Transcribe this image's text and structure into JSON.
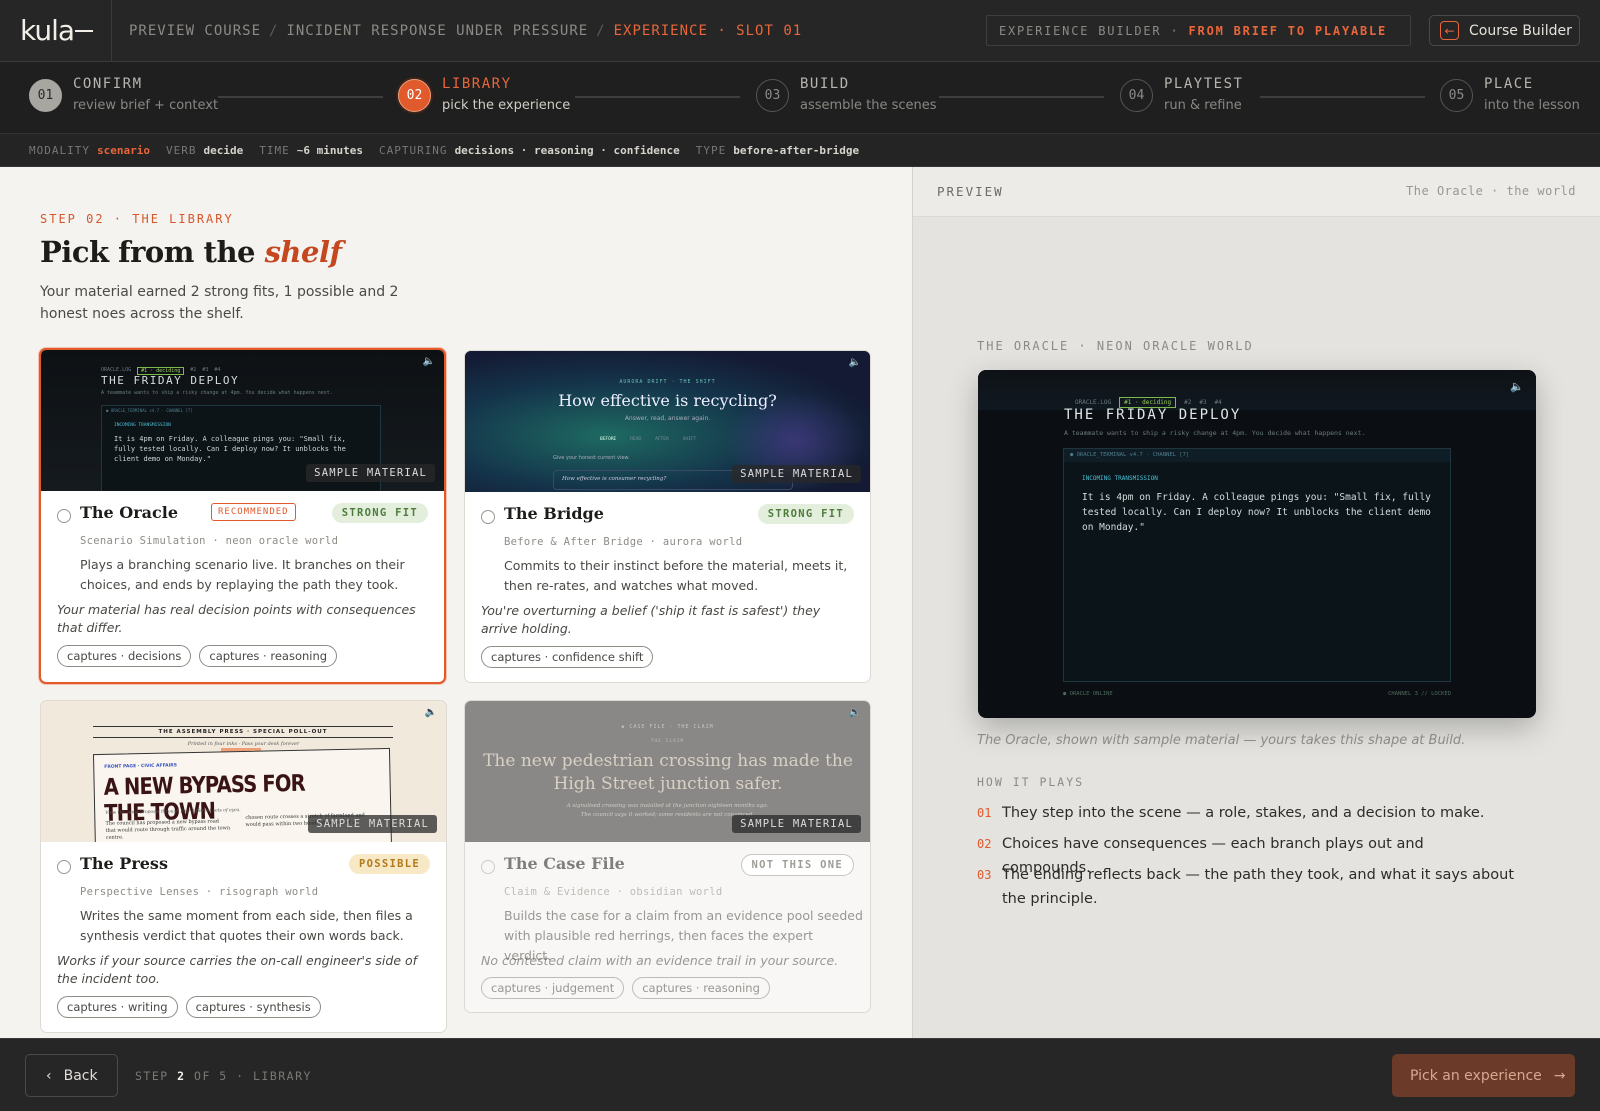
{
  "app": {
    "logo": "kula"
  },
  "breadcrumb": {
    "items": [
      "PREVIEW COURSE",
      "INCIDENT RESPONSE UNDER PRESSURE"
    ],
    "active": "EXPERIENCE · SLOT 01"
  },
  "builder_pill": {
    "label": "EXPERIENCE BUILDER ·",
    "highlight": "FROM BRIEF TO PLAYABLE"
  },
  "course_builder_button": {
    "label": "Course Builder"
  },
  "stepper": [
    {
      "num": "01",
      "title": "CONFIRM",
      "sub": "review brief + context",
      "state": "done"
    },
    {
      "num": "02",
      "title": "LIBRARY",
      "sub": "pick the experience",
      "state": "current"
    },
    {
      "num": "03",
      "title": "BUILD",
      "sub": "assemble the scenes",
      "state": "todo"
    },
    {
      "num": "04",
      "title": "PLAYTEST",
      "sub": "run & refine",
      "state": "todo"
    },
    {
      "num": "05",
      "title": "PLACE",
      "sub": "into the lesson",
      "state": "todo"
    }
  ],
  "meta": {
    "modality_k": "MODALITY",
    "modality_v": "scenario",
    "verb_k": "VERB",
    "verb_v": "decide",
    "time_k": "TIME",
    "time_v": "~6 minutes",
    "capturing_k": "CAPTURING",
    "capturing_v": "decisions · reasoning · confidence",
    "type_k": "TYPE",
    "type_v": "before-after-bridge"
  },
  "main": {
    "kicker": "STEP 02 · THE LIBRARY",
    "title_pre": "Pick from the",
    "title_em": "shelf",
    "lead": "Your material earned 2 strong fits, 1 possible and 2 honest noes across the shelf."
  },
  "sample_label": "SAMPLE MATERIAL",
  "cards": [
    {
      "name": "The Oracle",
      "badge": "STRONG FIT",
      "recommended": "RECOMMENDED",
      "sub": "Scenario Simulation · neon oracle world",
      "desc": "Plays a branching scenario live. It branches on their choices, and ends by replaying the path they took.",
      "why": "Your material has real decision points with consequences that differ.",
      "tags": [
        "captures · decisions",
        "captures · reasoning"
      ],
      "thumb": {
        "title": "THE FRIDAY DEPLOY",
        "tagline": "A teammate wants to ship a risky change at 4pm. You decide what happens next.",
        "msg": "It is 4pm on Friday. A colleague pings you: \"Small fix, fully tested locally. Can I deploy now? It unblocks the client demo on Monday.\"",
        "incoming": "INCOMING TRANSMISSION",
        "chip": "#1 · deciding",
        "chips": [
          "ORACLE.LOG",
          "#2",
          "#3",
          "#4"
        ],
        "terminal": "● ORACLE_TERMINAL v4.7 · CHANNEL [7]",
        "footer_l": "● ORACLE ONLINE",
        "footer_r": "CHANNEL 3 // LOCKED"
      }
    },
    {
      "name": "The Bridge",
      "badge": "STRONG FIT",
      "sub": "Before & After Bridge · aurora world",
      "desc": "Commits to their instinct before the material, meets it, then re-rates, and watches what moved.",
      "why": "You're overturning a belief ('ship it fast is safest') they arrive holding.",
      "tags": [
        "captures · confidence shift"
      ],
      "thumb": {
        "eyebrow": "AURORA DRIFT · THE SHIFT",
        "question": "How effective is recycling?",
        "sub": "Answer, read, answer again.",
        "steps": [
          "BEFORE",
          "READ",
          "AFTER",
          "SHIFT"
        ],
        "prompt": "Give your honest current view.",
        "input": "How effective is consumer recycling?"
      }
    },
    {
      "name": "The Press",
      "badge": "POSSIBLE",
      "sub": "Perspective Lenses · risograph world",
      "desc": "Writes the same moment from each side, then files a synthesis verdict that quotes their own words back.",
      "why": "Works if your source carries the on-call engineer's side of the incident too.",
      "tags": [
        "captures · writing",
        "captures · synthesis"
      ],
      "thumb": {
        "masthead": "THE ASSEMBLY PRESS · SPECIAL POLL-OUT",
        "strap": "Printed in four inks · Pass your desk forever",
        "section": "FRONT PAGE · CIVIC AFFAIRS",
        "headline": "A NEW BYPASS FOR THE TOWN",
        "deck": "View the same proposal through four different sets of eyes.",
        "col1": "The council has proposed a new bypass road that would route through traffic around the town centre.",
        "col2": "chosen route crosses a stretch of farmland and would pass within two hundred metres of a"
      }
    },
    {
      "name": "The Case File",
      "badge": "NOT THIS ONE",
      "sub": "Claim & Evidence · obsidian world",
      "desc": "Builds the case for a claim from an evidence pool seeded with plausible red herrings, then faces the expert verdict.",
      "why": "No contested claim with an evidence trail in your source.",
      "tags": [
        "captures · judgement",
        "captures · reasoning"
      ],
      "thumb": {
        "eyebrow": "◆ CASE FILE · THE CLAIM",
        "label": "THE CLAIM",
        "claim": "The new pedestrian crossing has made the High Street junction safer.",
        "note1": "A signalised crossing was installed at the junction eighteen months ago.",
        "note2": "The council says it worked; some residents are not convinced."
      }
    }
  ],
  "preview": {
    "label": "PREVIEW",
    "right": "The Oracle · the world",
    "kicker": "THE ORACLE · NEON ORACLE WORLD",
    "caption": "The Oracle, shown with sample material — yours takes this shape at Build.",
    "how_label": "HOW IT PLAYS",
    "how": [
      {
        "n": "01",
        "t": "They step into the scene — a role, stakes, and a decision to make."
      },
      {
        "n": "02",
        "t": "Choices have consequences — each branch plays out and compounds."
      },
      {
        "n": "03",
        "t": "The ending reflects back — the path they took, and what it says about the principle."
      }
    ]
  },
  "bottom": {
    "back": "Back",
    "step_pre": "STEP",
    "step_num": "2",
    "step_post": "OF 5 · LIBRARY",
    "cta": "Pick an experience"
  },
  "colors": {
    "accent": "#e05a2c",
    "strong": "#4e7c3c",
    "possible": "#b27a1c"
  }
}
